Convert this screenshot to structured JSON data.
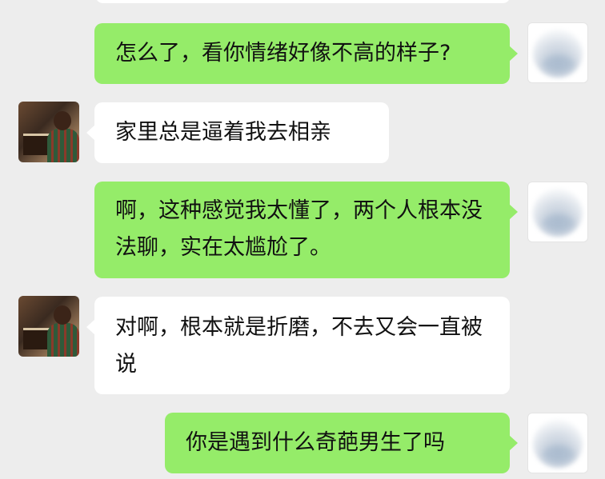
{
  "colors": {
    "background": "#ededed",
    "outgoing_bubble": "#95ec69",
    "incoming_bubble": "#ffffff",
    "text": "#111111"
  },
  "messages": [
    {
      "from": "self",
      "text": "怎么了，看你情绪好像不高的样子?"
    },
    {
      "from": "friend",
      "text": "家里总是逼着我去相亲"
    },
    {
      "from": "self",
      "text": "啊，这种感觉我太懂了，两个人根本没法聊，实在太尴尬了。"
    },
    {
      "from": "friend",
      "text": "对啊，根本就是折磨，不去又会一直被说"
    },
    {
      "from": "self",
      "text": "你是遇到什么奇葩男生了吗"
    }
  ]
}
